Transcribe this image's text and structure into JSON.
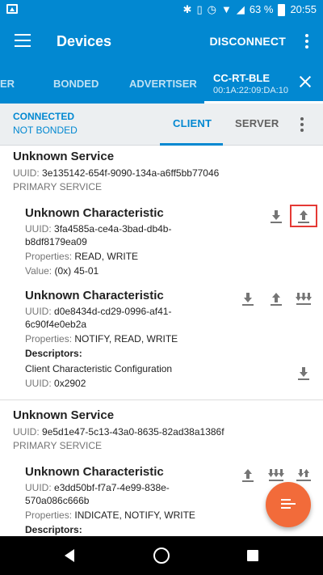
{
  "status_bar": {
    "battery": "63 %",
    "time": "20:55"
  },
  "toolbar": {
    "title": "Devices",
    "disconnect": "DISCONNECT"
  },
  "tabs": {
    "partial": "ER",
    "bonded": "BONDED",
    "advertiser": "ADVERTISER",
    "device_name": "CC-RT-BLE",
    "device_mac": "00:1A:22:09:DA:10"
  },
  "connection": {
    "status": "CONNECTED",
    "bond": "NOT BONDED"
  },
  "subtabs": {
    "client": "CLIENT",
    "server": "SERVER"
  },
  "labels": {
    "uuid": "UUID:",
    "properties": "Properties:",
    "value": "Value:",
    "descriptors": "Descriptors:"
  },
  "services": [
    {
      "name": "Unknown Service",
      "uuid": "3e135142-654f-9090-134a-a6ff5bb77046",
      "type": "PRIMARY SERVICE",
      "characteristics": [
        {
          "name": "Unknown Characteristic",
          "uuid_line1": "3fa4585a-ce4a-3bad-db4b-",
          "uuid_line2": "b8df8179ea09",
          "properties": "READ, WRITE",
          "value": "(0x) 45-01"
        },
        {
          "name": "Unknown Characteristic",
          "uuid_line1": "d0e8434d-cd29-0996-af41-",
          "uuid_line2": "6c90f4e0eb2a",
          "properties": "NOTIFY, READ, WRITE",
          "descriptor_name": "Client Characteristic Configuration",
          "descriptor_uuid": "0x2902"
        }
      ]
    },
    {
      "name": "Unknown Service",
      "uuid": "9e5d1e47-5c13-43a0-8635-82ad38a1386f",
      "type": "PRIMARY SERVICE",
      "characteristics": [
        {
          "name": "Unknown Characteristic",
          "uuid_line1": "e3dd50bf-f7a7-4e99-838e-",
          "uuid_line2": "570a086c666b",
          "properties": "INDICATE, NOTIFY, WRITE"
        }
      ]
    }
  ],
  "colors": {
    "primary": "#0288d1",
    "fab": "#f26b3a",
    "highlight": "#e53935"
  }
}
